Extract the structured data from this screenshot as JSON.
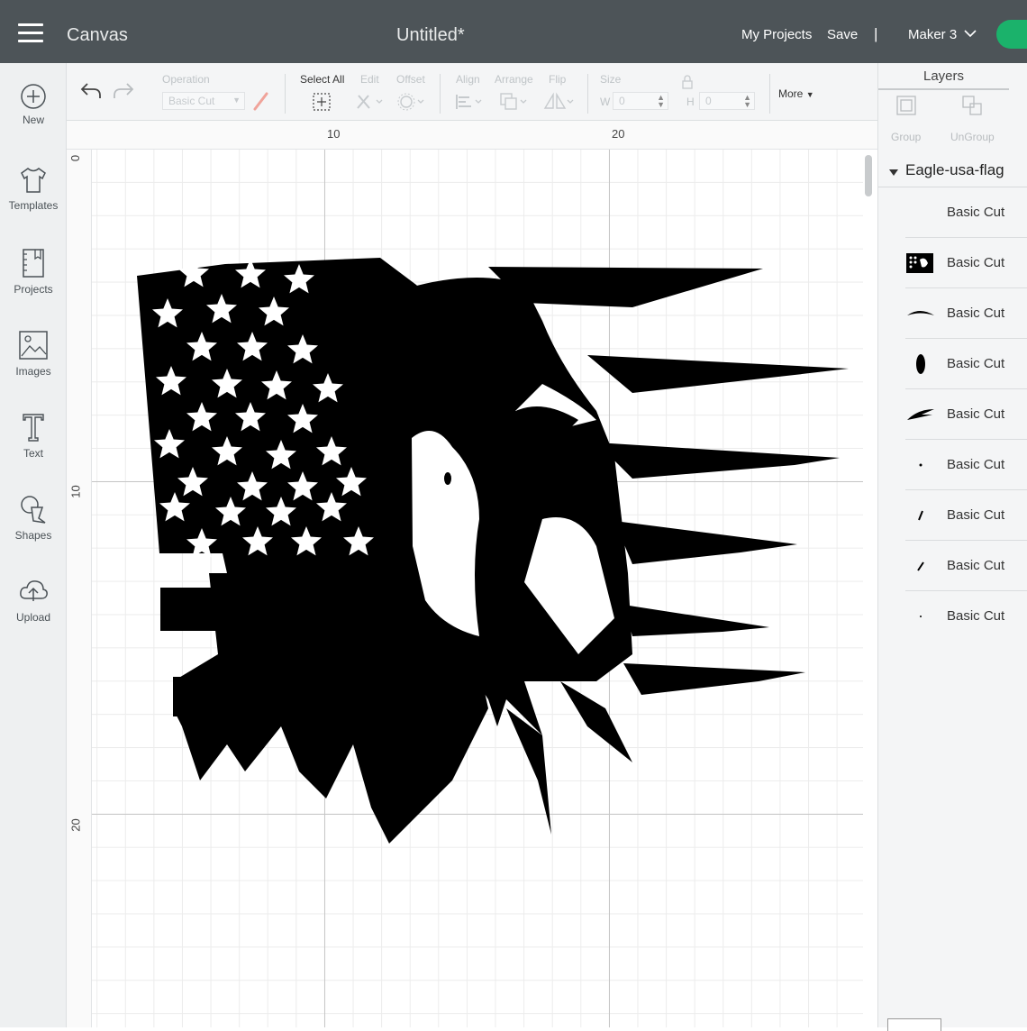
{
  "header": {
    "app_title": "Canvas",
    "doc_title": "Untitled*",
    "my_projects": "My Projects",
    "save": "Save",
    "separator": "|",
    "machine": "Maker 3"
  },
  "sidebar": {
    "items": [
      {
        "label": "New",
        "icon": "plus-circle-icon"
      },
      {
        "label": "Templates",
        "icon": "tshirt-icon"
      },
      {
        "label": "Projects",
        "icon": "projects-icon"
      },
      {
        "label": "Images",
        "icon": "image-icon"
      },
      {
        "label": "Text",
        "icon": "text-icon"
      },
      {
        "label": "Shapes",
        "icon": "shapes-icon"
      },
      {
        "label": "Upload",
        "icon": "upload-cloud-icon"
      }
    ]
  },
  "toolbar": {
    "operation_label": "Operation",
    "operation_value": "Basic Cut",
    "select_all": "Select All",
    "edit": "Edit",
    "offset": "Offset",
    "align": "Align",
    "arrange": "Arrange",
    "flip": "Flip",
    "size": "Size",
    "w_label": "W",
    "w_value": "0",
    "h_label": "H",
    "h_value": "0",
    "more": "More"
  },
  "ruler": {
    "h_ticks": [
      "10",
      "20"
    ],
    "v_ticks": [
      "0",
      "10",
      "20"
    ]
  },
  "panel": {
    "tab": "Layers",
    "group": "Group",
    "ungroup": "UnGroup",
    "group_name": "Eagle-usa-flag",
    "layers": [
      {
        "label": "Basic Cut",
        "thumb": "none"
      },
      {
        "label": "Basic Cut",
        "thumb": "eagle-flag-thumb"
      },
      {
        "label": "Basic Cut",
        "thumb": "brow-thumb"
      },
      {
        "label": "Basic Cut",
        "thumb": "oval-thumb"
      },
      {
        "label": "Basic Cut",
        "thumb": "feather-thumb"
      },
      {
        "label": "Basic Cut",
        "thumb": "dot-thumb"
      },
      {
        "label": "Basic Cut",
        "thumb": "slash-thumb"
      },
      {
        "label": "Basic Cut",
        "thumb": "slash-thumb"
      },
      {
        "label": "Basic Cut",
        "thumb": "dot-thumb"
      }
    ]
  },
  "colors": {
    "header_bg": "#4d5458",
    "make_button": "#1bb26b",
    "design_fill": "#000000"
  }
}
